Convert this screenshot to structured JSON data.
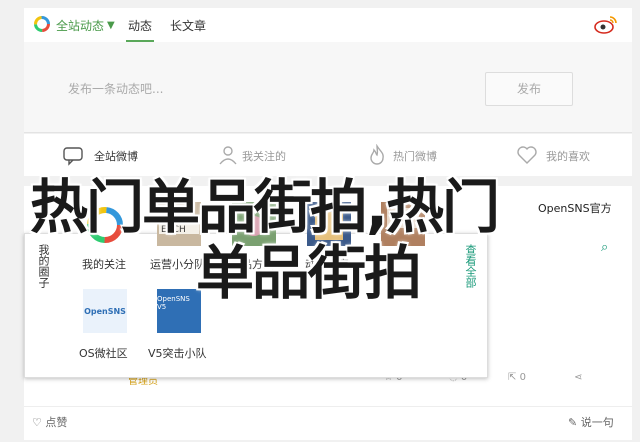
{
  "topbar": {
    "dropdown_label": "全站动态",
    "tabs": [
      {
        "label": "动态"
      },
      {
        "label": "长文章"
      }
    ]
  },
  "compose": {
    "placeholder": "发布一条动态吧...",
    "post_label": "发布"
  },
  "share": {
    "items": [
      {
        "label": "全站微博",
        "icon": "chat-bubble-icon"
      },
      {
        "label": "我关注的",
        "icon": "user-icon"
      },
      {
        "label": "热门微博",
        "icon": "flame-icon"
      },
      {
        "label": "我的喜欢",
        "icon": "heart-icon"
      }
    ]
  },
  "feed": {
    "author": "OpenSNS官方",
    "bottom": {
      "author_tag": "管理员",
      "reply_label": "☆ 0",
      "comment_label": "0",
      "repost_label": "0",
      "share_label": ""
    },
    "footer": {
      "like_label": "点赞",
      "say_label": "说一句"
    }
  },
  "popup": {
    "left_label": "我的圈子",
    "right_label": "查看全部",
    "items": [
      {
        "label": "我的关注"
      },
      {
        "label": "运营小分队"
      },
      {
        "label": "单品方法"
      },
      {
        "label": "动漫之家"
      },
      {
        "label": "OS微社区"
      },
      {
        "label": "V5突击小队"
      }
    ],
    "thumb1_text": "OpenSNS",
    "thumb2_text": "OpenSNS V5"
  },
  "overlay": {
    "line1": "热门单品街拍,热门",
    "line2": "单品街拍"
  },
  "colors": {
    "accent": "#5aa85a",
    "teal": "#1a9a7a",
    "brand_blue": "#2f6fb5"
  }
}
